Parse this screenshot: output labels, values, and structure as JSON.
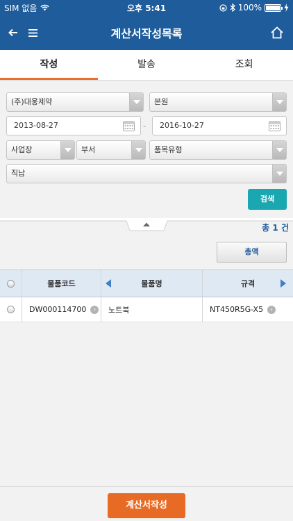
{
  "status_bar": {
    "carrier": "SIM 없음",
    "time": "오후 5:41",
    "battery": "100%"
  },
  "header": {
    "title": "계산서작성목록"
  },
  "tabs": [
    {
      "label": "작성",
      "active": true
    },
    {
      "label": "발송",
      "active": false
    },
    {
      "label": "조회",
      "active": false
    }
  ],
  "filters": {
    "company": "(주)대웅제약",
    "branch": "본원",
    "date_from": "2013-08-27",
    "date_separator": "-",
    "date_to": "2016-10-27",
    "workplace": "사업장",
    "department": "부서",
    "item_type": "품목유형",
    "delivery": "직납",
    "search_label": "검색"
  },
  "result": {
    "count_prefix": "총",
    "count": "1",
    "count_unit": "건"
  },
  "total_label": "총액",
  "table": {
    "headers": [
      "물품코드",
      "물품명",
      "규격"
    ],
    "rows": [
      {
        "code": "DW000114700",
        "name": "노트북",
        "spec": "NT450R5G-X5"
      }
    ]
  },
  "footer": {
    "create_label": "계산서작성"
  },
  "colors": {
    "primary": "#1f5c9c",
    "accent": "#e76b24",
    "search": "#1aa7b0"
  }
}
